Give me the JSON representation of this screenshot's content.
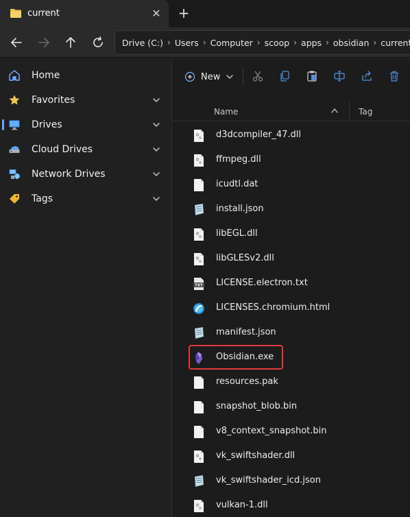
{
  "tab": {
    "title": "current",
    "close": "✕",
    "new_tab": "+"
  },
  "address": {
    "crumbs": [
      "Drive (C:)",
      "Users",
      "Computer",
      "scoop",
      "apps",
      "obsidian",
      "current"
    ],
    "separator": "›"
  },
  "sidebar": {
    "items": [
      {
        "label": "Home",
        "icon": "home-icon",
        "expandable": false,
        "selected": false
      },
      {
        "label": "Favorites",
        "icon": "star-icon",
        "expandable": true,
        "selected": false
      },
      {
        "label": "Drives",
        "icon": "monitor-icon",
        "expandable": true,
        "selected": true
      },
      {
        "label": "Cloud Drives",
        "icon": "cloud-drive-icon",
        "expandable": true,
        "selected": false
      },
      {
        "label": "Network Drives",
        "icon": "network-drive-icon",
        "expandable": true,
        "selected": false
      },
      {
        "label": "Tags",
        "icon": "tag-icon",
        "expandable": true,
        "selected": false
      }
    ]
  },
  "toolbar": {
    "new_label": "New"
  },
  "columns": {
    "name": "Name",
    "tag": "Tag"
  },
  "files": [
    {
      "name": "d3dcompiler_47.dll",
      "icon": "dll-icon"
    },
    {
      "name": "ffmpeg.dll",
      "icon": "dll-icon"
    },
    {
      "name": "icudtl.dat",
      "icon": "blank-file-icon"
    },
    {
      "name": "install.json",
      "icon": "json-icon"
    },
    {
      "name": "libEGL.dll",
      "icon": "dll-icon"
    },
    {
      "name": "libGLESv2.dll",
      "icon": "dll-icon"
    },
    {
      "name": "LICENSE.electron.txt",
      "icon": "txt-icon"
    },
    {
      "name": "LICENSES.chromium.html",
      "icon": "html-icon"
    },
    {
      "name": "manifest.json",
      "icon": "json-icon"
    },
    {
      "name": "Obsidian.exe",
      "icon": "obsidian-icon",
      "highlighted": true
    },
    {
      "name": "resources.pak",
      "icon": "blank-file-icon"
    },
    {
      "name": "snapshot_blob.bin",
      "icon": "blank-file-icon"
    },
    {
      "name": "v8_context_snapshot.bin",
      "icon": "blank-file-icon"
    },
    {
      "name": "vk_swiftshader.dll",
      "icon": "dll-icon"
    },
    {
      "name": "vk_swiftshader_icd.json",
      "icon": "json-icon"
    },
    {
      "name": "vulkan-1.dll",
      "icon": "dll-icon"
    }
  ],
  "colors": {
    "accent": "#6aa5ff",
    "highlight": "#e0393b",
    "folder": "#f3c34c"
  }
}
